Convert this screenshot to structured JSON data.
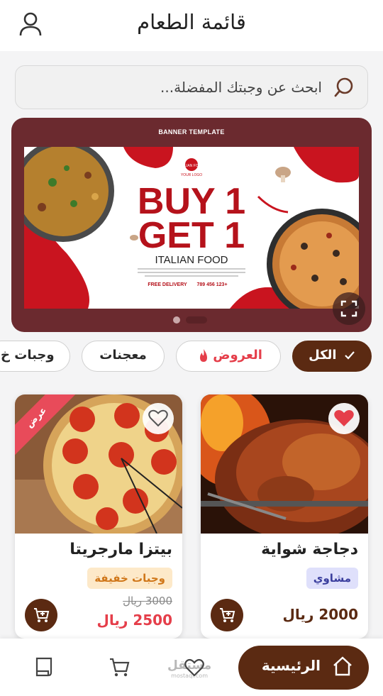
{
  "header": {
    "title": "قائمة الطعام",
    "user_icon": "user-icon"
  },
  "search": {
    "placeholder": "ابحث عن وجبتك المفضلة..."
  },
  "banner": {
    "label": "BANNER TEMPLATE",
    "headline_1": "BUY 1",
    "headline_2": "GET 1",
    "subtitle": "ITALIAN FOOD",
    "logo_text": "YOUR LOGO",
    "logo_name": "ITALIAN FOOD",
    "delivery": "FREE DELIVERY",
    "phone": "+123 456 789",
    "slides": 2,
    "active_slide": 2
  },
  "categories": [
    {
      "label": "الكل",
      "active": true
    },
    {
      "label": "العروض",
      "active": false
    },
    {
      "label": "معجنات",
      "active": false
    },
    {
      "label": "وجبات خ",
      "active": false
    }
  ],
  "products": [
    {
      "name": "دجاجة شواية",
      "tag": "مشاوي",
      "price": "2000 ريال",
      "favorite": true
    },
    {
      "name": "بيتزا مارجريتا",
      "tag": "وجبات خفيفة",
      "old_price": "3000 ريال",
      "price": "2500 ريال",
      "ribbon": "عرض",
      "favorite": false
    }
  ],
  "bottom_nav": {
    "home_label": "الرئيسية",
    "watermark": "مستقل",
    "watermark_sub": "mostaql.com"
  },
  "colors": {
    "brand_brown": "#5b2a12",
    "banner_bg": "#6b2a2f",
    "accent_red": "#e53e4a",
    "tag_grill_bg": "#dfe0fb",
    "tag_snack_bg": "#fde9c9"
  }
}
